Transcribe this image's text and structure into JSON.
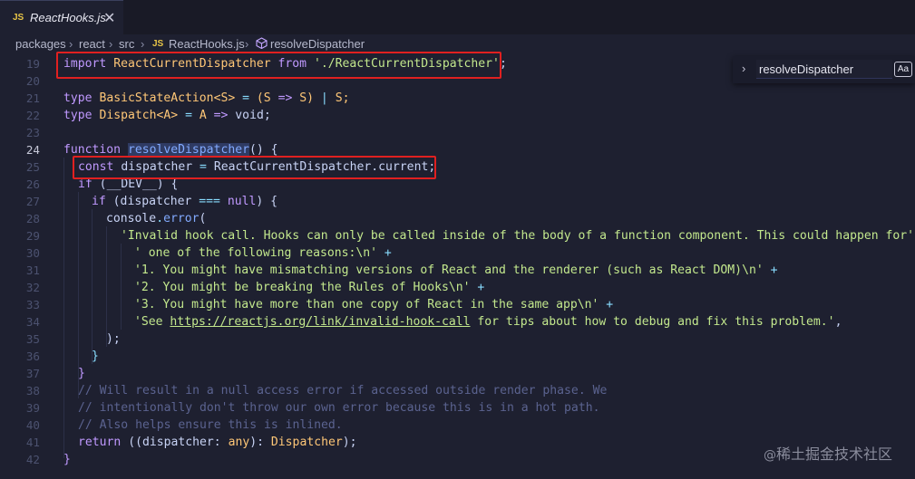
{
  "tab": {
    "badge": "JS",
    "title": "ReactHooks.js",
    "close_glyph": "✕"
  },
  "breadcrumb": {
    "items": [
      "packages",
      "react",
      "src",
      "ReactHooks.js",
      "resolveDispatcher"
    ],
    "file_badge": "JS",
    "separator": "›"
  },
  "find_widget": {
    "query": "resolveDispatcher",
    "match_case": "Aa"
  },
  "line_numbers": [
    "19",
    "20",
    "21",
    "22",
    "23",
    "24",
    "25",
    "26",
    "27",
    "28",
    "29",
    "30",
    "31",
    "32",
    "33",
    "34",
    "35",
    "36",
    "37",
    "38",
    "39",
    "40",
    "41",
    "42"
  ],
  "active_line": "24",
  "code": {
    "l19": {
      "import": "import",
      "name": "ReactCurrentDispatcher",
      "from": "from",
      "path": "'./ReactCurrentDispatcher'",
      "semi": ";"
    },
    "l21": {
      "type": "type",
      "name": "BasicStateAction",
      "generic": "<S>",
      "eq": "=",
      "body1": "(S",
      "arrow": "=>",
      "body2": "S)",
      "pipe": "|",
      "body3": "S;"
    },
    "l22": {
      "type": "type",
      "name": "Dispatch",
      "generic": "<A>",
      "eq": "=",
      "a": "A",
      "arrow": "=>",
      "void": "void;"
    },
    "l24": {
      "function": "function",
      "name": "resolveDispatcher",
      "rest": "() {"
    },
    "l25": {
      "const": "const",
      "name": "dispatcher",
      "eq": "=",
      "obj": "ReactCurrentDispatcher",
      "prop": ".current;"
    },
    "l26": {
      "if": "if",
      "rest1": "(",
      "dev": "__DEV__",
      "rest2": ") {"
    },
    "l27": {
      "if": "if",
      "rest1": "(dispatcher",
      "eqeq": "===",
      "null": "null",
      "rest2": ") {"
    },
    "l28": {
      "obj": "console",
      "dot": ".",
      "method": "error",
      "paren": "("
    },
    "l29": {
      "str": "'Invalid hook call. Hooks can only be called inside of the body of a function component. This could happen for'",
      "plus": " +"
    },
    "l30": {
      "str": "' one of the following reasons:\\n'",
      "plus": " +"
    },
    "l31": {
      "str": "'1. You might have mismatching versions of React and the renderer (such as React DOM)\\n'",
      "plus": " +"
    },
    "l32": {
      "str": "'2. You might be breaking the Rules of Hooks\\n'",
      "plus": " +"
    },
    "l33": {
      "str": "'3. You might have more than one copy of React in the same app\\n'",
      "plus": " +"
    },
    "l34": {
      "pre": "'See ",
      "link": "https://reactjs.org/link/invalid-hook-call",
      "post": " for tips about how to debug and fix this problem.'",
      "comma": ","
    },
    "l35": {
      "text": ");"
    },
    "l36": {
      "text": "}"
    },
    "l37": {
      "text": "}"
    },
    "l38": {
      "text": "// Will result in a null access error if accessed outside render phase. We"
    },
    "l39": {
      "text": "// intentionally don't throw our own error because this is in a hot path."
    },
    "l40": {
      "text": "// Also helps ensure this is inlined."
    },
    "l41": {
      "return": "return",
      "rest1": "((dispatcher:",
      "any": "any",
      "rest2": "):",
      "type": "Dispatcher",
      "rest3": ");"
    },
    "l42": {
      "text": "}"
    }
  },
  "watermark": {
    "at": "@",
    "text": "稀土掘金技术社区"
  },
  "colors": {
    "background": "#1e2030",
    "keyword": "#c099ff",
    "string": "#c3e88d",
    "type": "#ffc777",
    "highlight_box": "#e02020"
  }
}
